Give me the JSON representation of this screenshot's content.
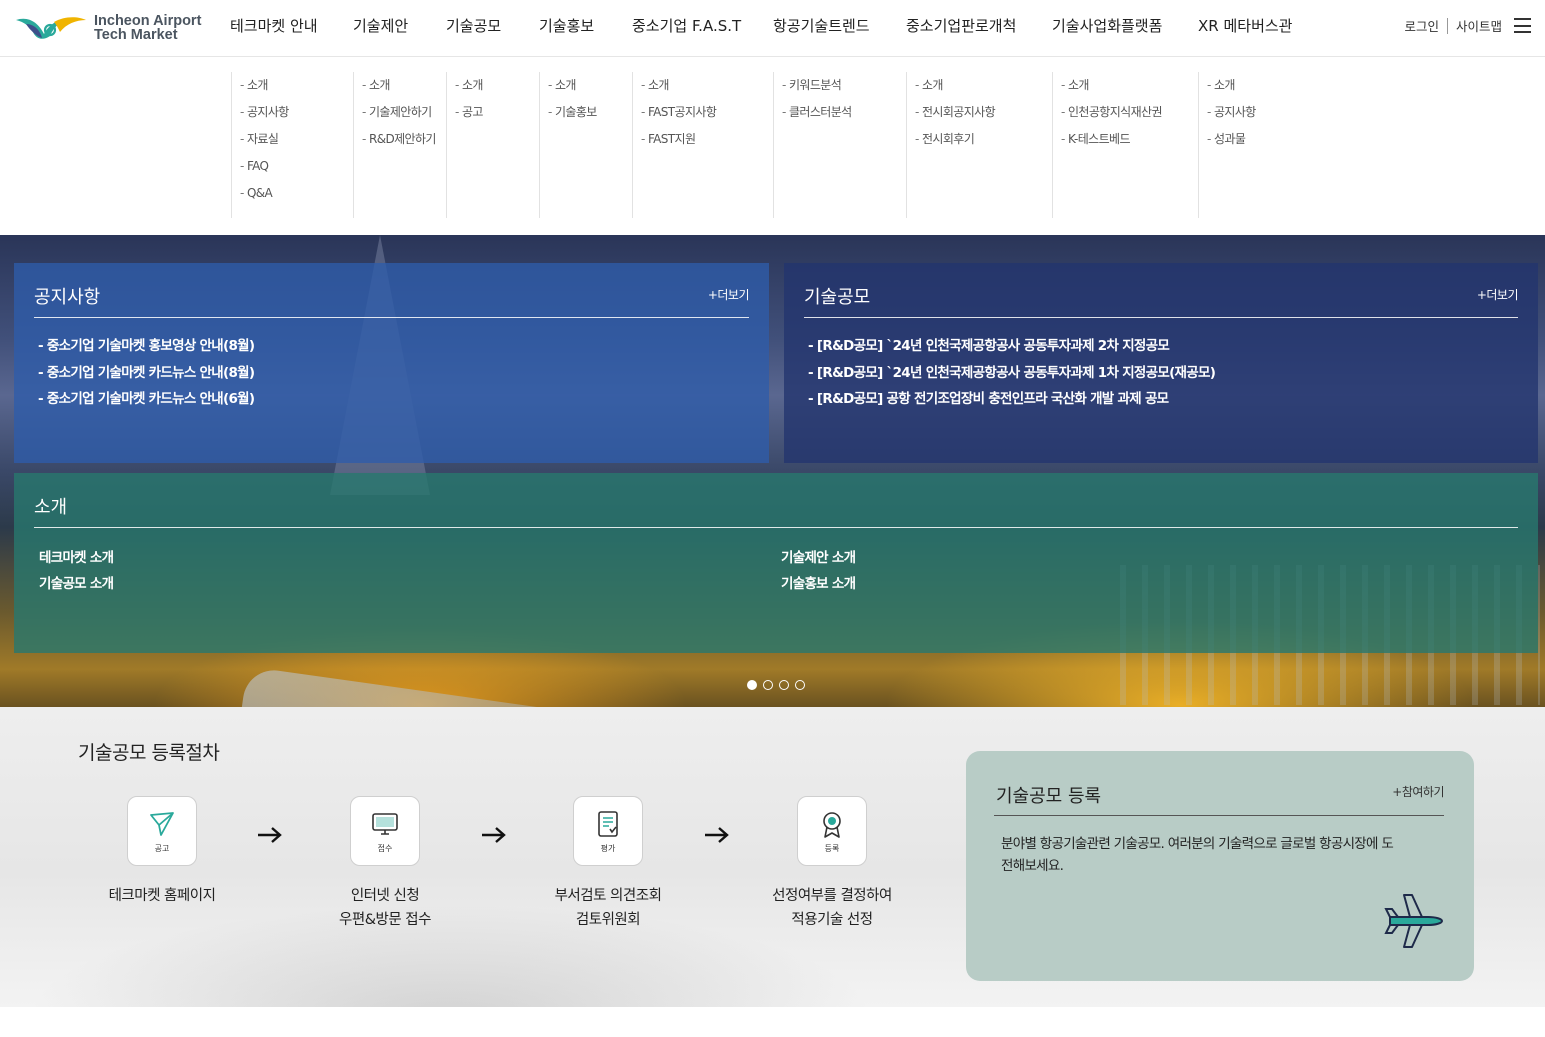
{
  "header": {
    "logo_line1": "Incheon Airport",
    "logo_line2": "Tech Market",
    "nav": [
      {
        "label": "테크마켓 안내"
      },
      {
        "label": "기술제안"
      },
      {
        "label": "기술공모"
      },
      {
        "label": "기술홍보"
      },
      {
        "label": "중소기업 F.A.S.T"
      },
      {
        "label": "항공기술트렌드"
      },
      {
        "label": "중소기업판로개척"
      },
      {
        "label": "기술사업화플랫폼"
      },
      {
        "label": "XR 메타버스관"
      }
    ],
    "login": "로그인",
    "sitemap": "사이트맵"
  },
  "mega_menu": [
    {
      "items": [
        "소개",
        "공지사항",
        "자료실",
        "FAQ",
        "Q&A"
      ]
    },
    {
      "items": [
        "소개",
        "기술제안하기",
        "R&D제안하기"
      ]
    },
    {
      "items": [
        "소개",
        "공고"
      ]
    },
    {
      "items": [
        "소개",
        "기술홍보"
      ]
    },
    {
      "items": [
        "소개",
        "FAST공지사항",
        "FAST지원"
      ]
    },
    {
      "items": [
        "키워드분석",
        "클러스터분석"
      ]
    },
    {
      "items": [
        "소개",
        "전시회공지사항",
        "전시회후기"
      ]
    },
    {
      "items": [
        "소개",
        "인천공항지식재산권",
        "K-테스트베드"
      ]
    },
    {
      "items": [
        "소개",
        "공지사항",
        "성과물"
      ]
    }
  ],
  "notice": {
    "title": "공지사항",
    "more": "+더보기",
    "items": [
      "중소기업 기술마켓 홍보영상 안내(8월)",
      "중소기업 기술마켓 카드뉴스 안내(8월)",
      "중소기업 기술마켓 카드뉴스 안내(6월)"
    ]
  },
  "contest": {
    "title": "기술공모",
    "more": "+더보기",
    "items": [
      "[R&D공모] `24년 인천국제공항공사 공동투자과제 2차 지정공모",
      "[R&D공모] `24년 인천국제공항공사 공동투자과제 1차 지정공모(재공모)",
      "[R&D공모] 공항 전기조업장비 충전인프라 국산화 개발 과제 공모"
    ]
  },
  "intro": {
    "title": "소개",
    "links": [
      "테크마켓 소개",
      "기술공모 소개",
      "기술제안 소개",
      "기술홍보 소개"
    ]
  },
  "slider": {
    "dot_count": 4,
    "active_index": 0
  },
  "procedure": {
    "title": "기술공모 등록절차",
    "steps": [
      {
        "icon": "paper-plane-icon",
        "caption": "공고",
        "line1": "테크마켓 홈페이지",
        "line2": ""
      },
      {
        "icon": "monitor-icon",
        "caption": "접수",
        "line1": "인터넷 신청",
        "line2": "우편&방문 접수"
      },
      {
        "icon": "document-icon",
        "caption": "평가",
        "line1": "부서검토 의견조회",
        "line2": "검토위원회"
      },
      {
        "icon": "award-badge-icon",
        "caption": "등록",
        "line1": "선정여부를 결정하여",
        "line2": "적용기술 선정"
      }
    ]
  },
  "register": {
    "title": "기술공모 등록",
    "more": "+참여하기",
    "desc": "분야별 항공기술관련 기술공모. 여러분의 기술력으로 글로벌 항공시장에 도전해보세요."
  },
  "colors": {
    "accent_teal": "#2aa99b",
    "notice_panel": "#2e5caa",
    "contest_panel": "#22346e",
    "intro_panel": "#28786e",
    "register_card": "#b8ccc6"
  }
}
